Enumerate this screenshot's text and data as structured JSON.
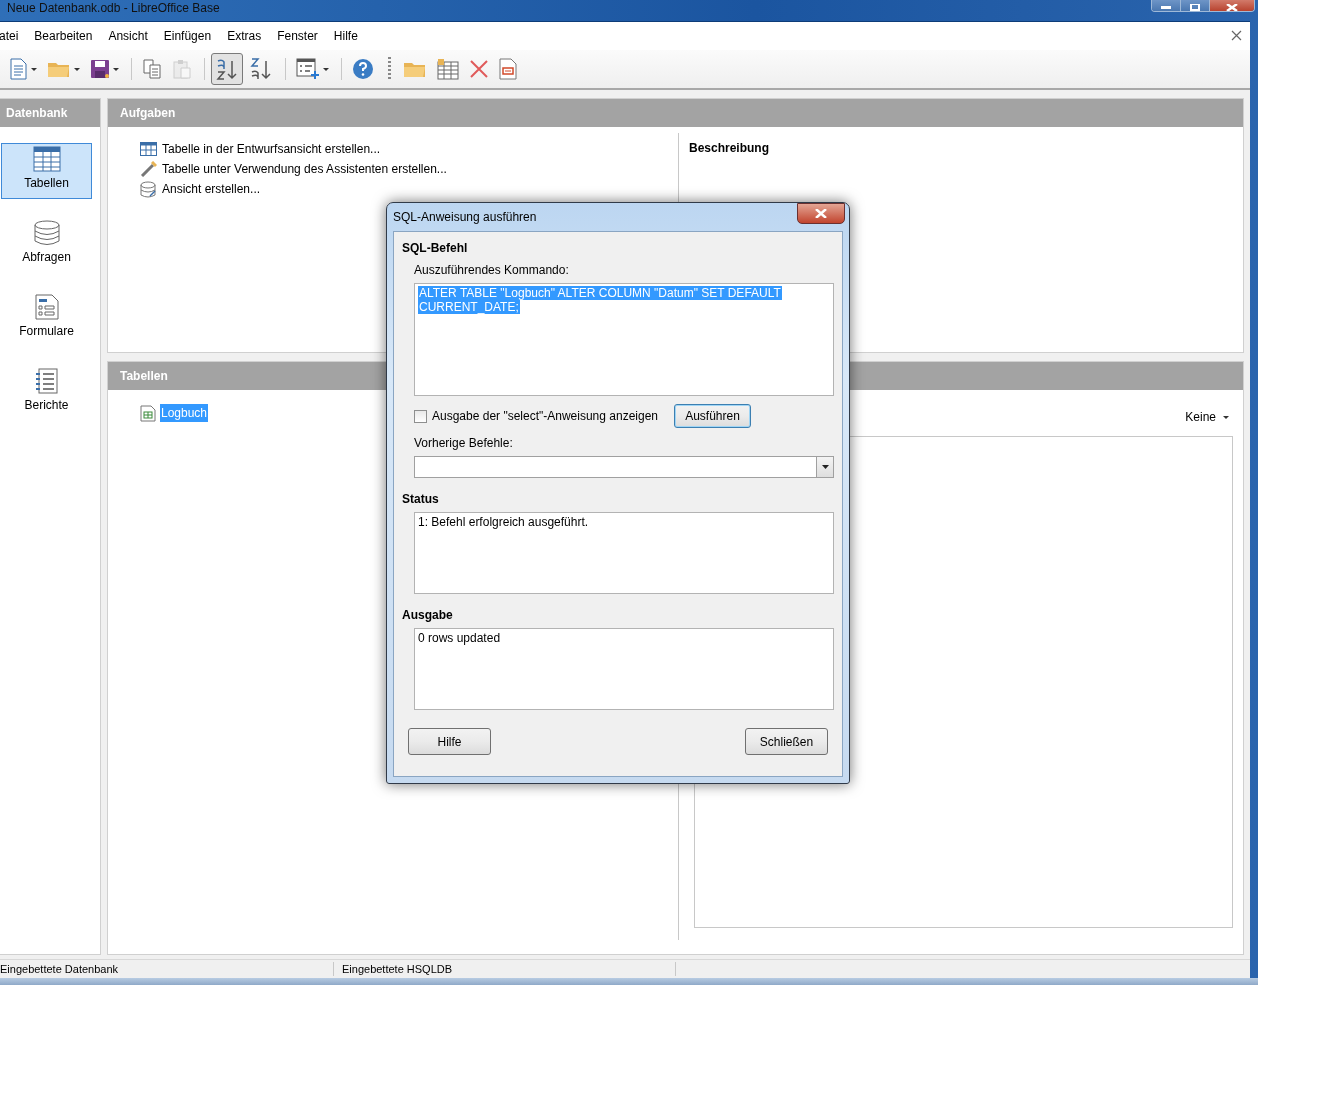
{
  "window": {
    "title": "Neue Datenbank.odb - LibreOffice Base"
  },
  "menu": [
    {
      "label": "atei"
    },
    {
      "label": "Bearbeiten"
    },
    {
      "label": "Ansicht"
    },
    {
      "label": "Einfügen"
    },
    {
      "label": "Extras"
    },
    {
      "label": "Fenster"
    },
    {
      "label": "Hilfe"
    }
  ],
  "toolbar": [
    {
      "kind": "new",
      "dropdown": true,
      "pressed": false,
      "disabled": false
    },
    {
      "kind": "open",
      "dropdown": true,
      "pressed": false,
      "disabled": false
    },
    {
      "kind": "save",
      "dropdown": true,
      "pressed": false,
      "disabled": false
    },
    {
      "kind": "separator"
    },
    {
      "kind": "copy",
      "dropdown": false,
      "pressed": false,
      "disabled": false
    },
    {
      "kind": "paste",
      "dropdown": false,
      "pressed": false,
      "disabled": true
    },
    {
      "kind": "separator"
    },
    {
      "kind": "sort-asc",
      "dropdown": false,
      "pressed": true,
      "disabled": false
    },
    {
      "kind": "sort-desc",
      "dropdown": false,
      "pressed": false,
      "disabled": false
    },
    {
      "kind": "separator"
    },
    {
      "kind": "form",
      "dropdown": true,
      "pressed": false,
      "disabled": false
    },
    {
      "kind": "separator"
    },
    {
      "kind": "help",
      "dropdown": false,
      "pressed": false,
      "disabled": false
    },
    {
      "kind": "grip"
    },
    {
      "kind": "folder",
      "dropdown": false,
      "pressed": false,
      "disabled": false
    },
    {
      "kind": "table",
      "dropdown": false,
      "pressed": false,
      "disabled": false
    },
    {
      "kind": "delete",
      "dropdown": false,
      "pressed": false,
      "disabled": false
    },
    {
      "kind": "report",
      "dropdown": false,
      "pressed": false,
      "disabled": false
    }
  ],
  "sidebar": {
    "title": "Datenbank",
    "items": [
      {
        "label": "Tabellen",
        "kind": "table",
        "selected": true
      },
      {
        "label": "Abfragen",
        "kind": "query",
        "selected": false
      },
      {
        "label": "Formulare",
        "kind": "form",
        "selected": false
      },
      {
        "label": "Berichte",
        "kind": "report",
        "selected": false
      }
    ]
  },
  "tasks_panel": {
    "title": "Aufgaben",
    "tasks": [
      {
        "label": "Tabelle in der Entwurfsansicht erstellen...",
        "kind": "design"
      },
      {
        "label": "Tabelle unter Verwendung des Assistenten erstellen...",
        "kind": "wizard"
      },
      {
        "label": "Ansicht erstellen...",
        "kind": "view"
      }
    ],
    "description_title": "Beschreibung"
  },
  "tables_panel": {
    "title": "Tabellen",
    "items": [
      {
        "label": "Logbuch",
        "selected": true
      }
    ],
    "preview_mode": "Keine"
  },
  "dialog": {
    "title": "SQL-Anweisung ausführen",
    "command_section": "SQL-Befehl",
    "command_label": "Auszuführendes Kommando:",
    "command_lines": [
      "ALTER TABLE \"Logbuch\" ALTER COLUMN \"Datum\" SET DEFAULT",
      "CURRENT_DATE;"
    ],
    "command_selected": true,
    "show_select": {
      "label": "Ausgabe der \"select\"-Anweisung anzeigen",
      "checked": false
    },
    "execute_button": "Ausführen",
    "history_label": "Vorherige Befehle:",
    "status_title": "Status",
    "status": "1: Befehl erfolgreich ausgeführt.",
    "output_title": "Ausgabe",
    "output": "0 rows updated",
    "help_button": "Hilfe",
    "close_button": "Schließen"
  },
  "status_bar": [
    "Eingebettete Datenbank",
    "Eingebettete HSQLDB"
  ]
}
